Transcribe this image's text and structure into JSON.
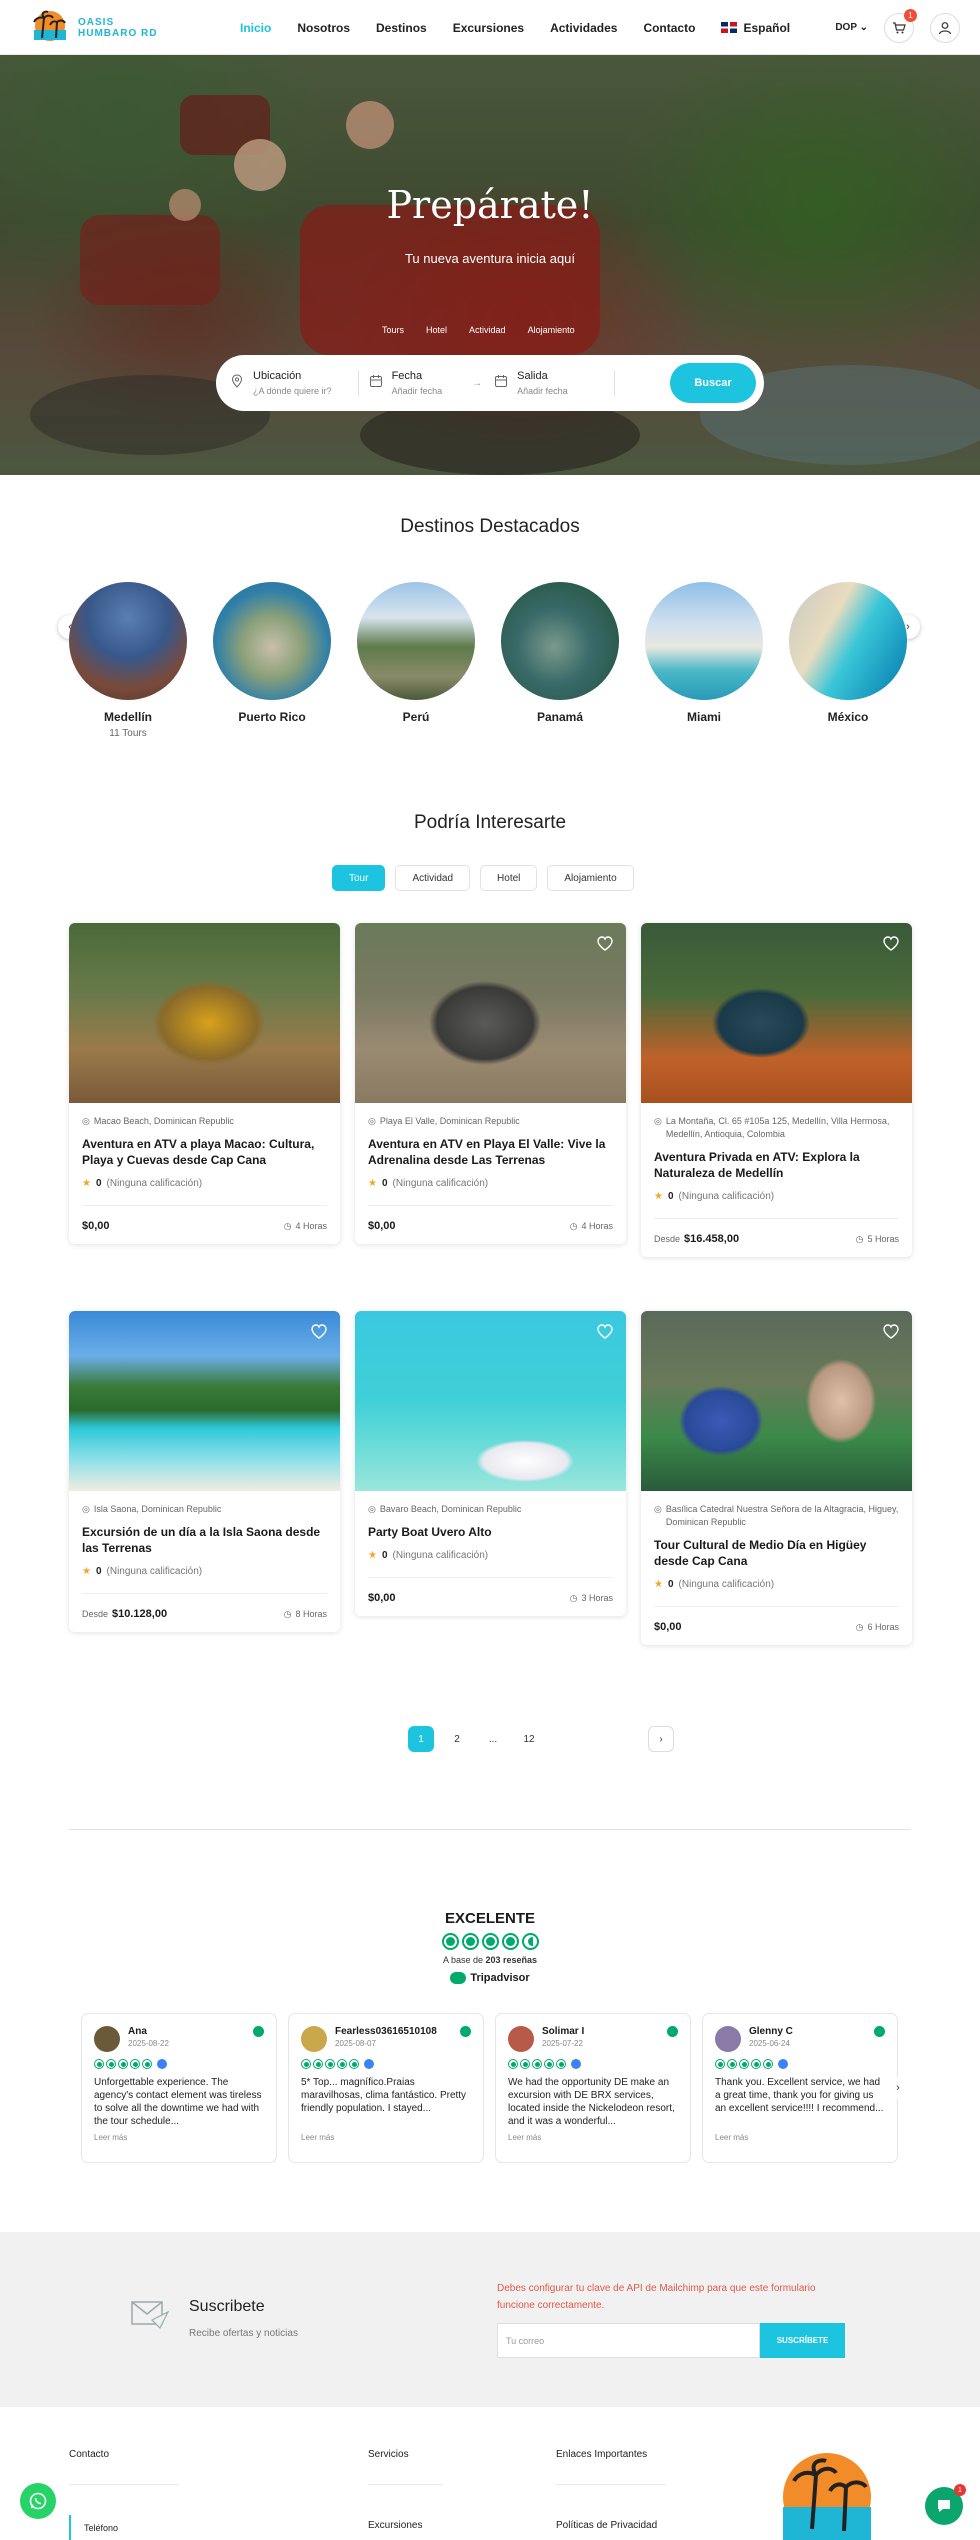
{
  "header": {
    "logo_line1": "OASIS",
    "logo_line2": "HUMBARO RD",
    "nav": [
      "Inicio",
      "Nosotros",
      "Destinos",
      "Excursiones",
      "Actividades",
      "Contacto"
    ],
    "language": "Español",
    "currency": "DOP",
    "cart_count": "1"
  },
  "hero": {
    "title": "Prepárate!",
    "subtitle": "Tu nueva aventura inicia aquí",
    "tabs": [
      "Tours",
      "Hotel",
      "Actividad",
      "Alojamiento"
    ],
    "search": {
      "location_label": "Ubicación",
      "location_placeholder": "¿A dónde quiere ir?",
      "date_label": "Fecha",
      "date_placeholder": "Añadir fecha",
      "checkout_label": "Salida",
      "checkout_placeholder": "Añadir fecha",
      "button": "Buscar"
    }
  },
  "destinations": {
    "title": "Destinos Destacados",
    "items": [
      {
        "name": "Medellín",
        "count": "11 Tours"
      },
      {
        "name": "Puerto Rico",
        "count": ""
      },
      {
        "name": "Perú",
        "count": ""
      },
      {
        "name": "Panamá",
        "count": ""
      },
      {
        "name": "Miami",
        "count": ""
      },
      {
        "name": "México",
        "count": ""
      }
    ]
  },
  "interest": {
    "title": "Podría Interesarte",
    "tabs": [
      "Tour",
      "Actividad",
      "Hotel",
      "Alojamiento"
    ],
    "cards": [
      {
        "location": "Macao Beach, Dominican Republic",
        "title": "Aventura en ATV a playa Macao: Cultura, Playa y Cuevas desde Cap Cana",
        "rating": "0",
        "rating_text": "(Ninguna calificación)",
        "price_prefix": "",
        "price": "$0,00",
        "duration": "4 Horas"
      },
      {
        "location": "Playa El Valle, Dominican Republic",
        "title": "Aventura en ATV en Playa El Valle: Vive la Adrenalina desde Las Terrenas",
        "rating": "0",
        "rating_text": "(Ninguna calificación)",
        "price_prefix": "",
        "price": "$0,00",
        "duration": "4 Horas"
      },
      {
        "location": "La Montaña, Cl. 65 #105a 125, Medellín, Villa Hermosa, Medellín, Antioquia, Colombia",
        "title": "Aventura Privada en ATV: Explora la Naturaleza de Medellín",
        "rating": "0",
        "rating_text": "(Ninguna calificación)",
        "price_prefix": "Desde",
        "price": "$16.458,00",
        "duration": "5 Horas"
      },
      {
        "location": "Isla Saona, Dominican Republic",
        "title": "Excursión de un día a la Isla Saona desde las Terrenas",
        "rating": "0",
        "rating_text": "(Ninguna calificación)",
        "price_prefix": "Desde",
        "price": "$10.128,00",
        "duration": "8 Horas"
      },
      {
        "location": "Bavaro Beach, Dominican Republic",
        "title": "Party Boat Uvero Alto",
        "rating": "0",
        "rating_text": "(Ninguna calificación)",
        "price_prefix": "",
        "price": "$0,00",
        "duration": "3 Horas"
      },
      {
        "location": "Basílica Catedral Nuestra Señora de la Altagracia, Higuey, Dominican Republic",
        "title": "Tour Cultural de Medio Día en Higüey desde Cap Cana",
        "rating": "0",
        "rating_text": "(Ninguna calificación)",
        "price_prefix": "",
        "price": "$0,00",
        "duration": "6 Horas"
      }
    ],
    "pagination": [
      "1",
      "2",
      "...",
      "12",
      "›"
    ]
  },
  "reviews": {
    "rating_word": "EXCELENTE",
    "base_prefix": "A base de",
    "base_count": "203 reseñas",
    "brand": "Tripadvisor",
    "read_more": "Leer más",
    "items": [
      {
        "name": "Ana",
        "date": "2025-08-22",
        "text": "Unforgettable experience. The agency's contact element was tireless to solve all the downtime we had with the tour schedule..."
      },
      {
        "name": "Fearless03616510108",
        "date": "2025-08-07",
        "text": "5* Top... magnífico.Praias maravilhosas, clima fantástico. Pretty friendly population. I stayed..."
      },
      {
        "name": "Solimar I",
        "date": "2025-07-22",
        "text": "We had the opportunity DE make an excursion with DE BRX services, located inside the Nickelodeon resort, and it was a wonderful..."
      },
      {
        "name": "Glenny C",
        "date": "2025-06-24",
        "text": "Thank you. Excellent service, we had a great time, thank you for giving us an excellent service!!!! I recommend..."
      }
    ]
  },
  "subscribe": {
    "title": "Suscribete",
    "description": "Recibe ofertas y noticias",
    "error": "Debes configurar tu clave de API de Mailchimp para que este formulario funcione correctamente.",
    "placeholder": "Tu correo",
    "button": "SUSCRÍBETE"
  },
  "footer": {
    "contact_title": "Contacto",
    "contact_phone": "Teléfono",
    "services_title": "Servicios",
    "services_link": "Excursiones",
    "links_title": "Enlaces Importantes",
    "links_link": "Políticas de Privacidad",
    "chat_badge": "1"
  },
  "colors": {
    "accent": "#1cc4e0",
    "tripadvisor": "#00aa6c",
    "error": "#e05a47"
  }
}
